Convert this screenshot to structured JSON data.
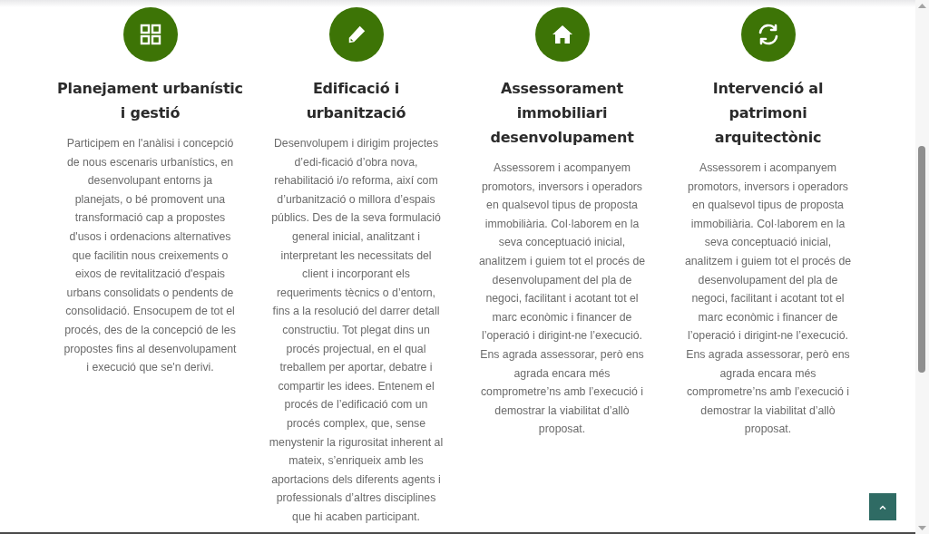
{
  "services": [
    {
      "title": "Planejament urbanístic i gestió",
      "text": "Participem en l'anàlisi i concepció de nous escenaris urbanístics, en desenvolupant entorns ja planejats, o bé promovent una transformació cap a propostes d'usos i ordenacions alternatives que facilitin nous creixements o eixos de revitalització d'espais urbans consolidats o pendents de consolidació. Ensocupem de tot el procés, des de la concepció de les propostes fins al desenvolupament i execució que se'n derivi."
    },
    {
      "title": "Edificació i urbanització",
      "text": "Desenvolupem i dirigim projectes d’edi-ficació d’obra nova, rehabilitació i/o reforma, així com d’urbanització o millora d’espais públics. Des de la seva formulació general inicial, analitzant i interpretant les necessitats del client i incorporant els requeriments tècnics o d’entorn, fins a la resolució del darrer detall constructiu. Tot plegat dins un procés projectual, en el qual treballem per aportar, debatre i compartir les idees. Entenem el procés de l’edificació com un procés complex, que, sense menystenir la rigurositat inherent al mateix, s’enriqueix amb les aportacions dels diferents agents i professionals d’altres disciplines que hi acaben participant."
    },
    {
      "title": "Assessorament immobiliari desenvolupament",
      "text": "Assessorem i acompanyem promotors, inversors i operadors en qualsevol tipus de proposta immobiliària. Col·laborem en la seva conceptuació inicial, analitzem i guiem tot el procés de desenvolupament del pla de negoci, facilitant i acotant tot el marc econòmic i financer de l’operació i dirigint-ne l’execució. Ens agrada assessorar, però ens agrada encara més comprometre’ns amb l’execució i demostrar la viabilitat d’allò proposat."
    },
    {
      "title": "Intervenció al patrimoni arquitectònic",
      "text": "Assessorem i acompanyem promotors, inversors i operadors en qualsevol tipus de proposta immobiliària. Col·laborem en la seva conceptuació inicial, analitzem i guiem tot el procés de desenvolupament del pla de negoci, facilitant i acotant tot el marc econòmic i financer de l’operació i dirigint-ne l’execució. Ens agrada assessorar, però ens agrada encara més comprometre’ns amb l’execució i demostrar la viabilitat d’allò proposat."
    }
  ]
}
